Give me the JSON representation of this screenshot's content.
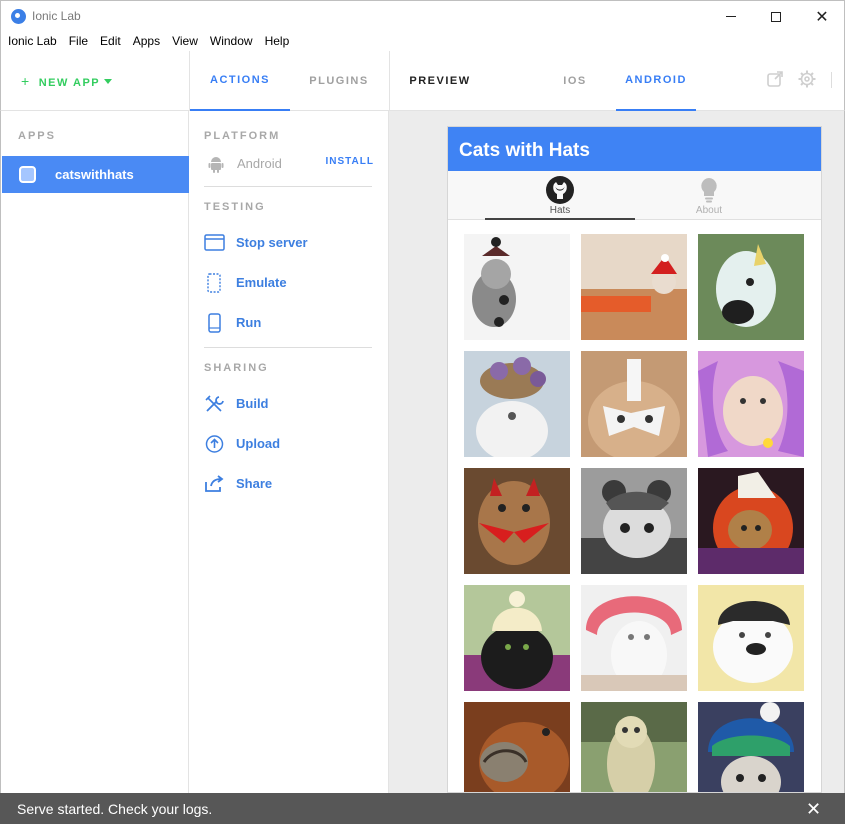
{
  "window": {
    "title": "Ionic Lab"
  },
  "menu": [
    "Ionic Lab",
    "File",
    "Edit",
    "Apps",
    "View",
    "Window",
    "Help"
  ],
  "header": {
    "new_app": "NEW APP",
    "tabs": {
      "actions": "ACTIONS",
      "plugins": "PLUGINS",
      "preview": "PREVIEW",
      "ios": "IOS",
      "android": "ANDROID"
    },
    "active_tab": "ACTIONS",
    "active_platform": "ANDROID"
  },
  "sidebar": {
    "section": "APPS",
    "apps": [
      {
        "name": "catswithhats",
        "selected": true
      }
    ]
  },
  "actions": {
    "platform_section": "PLATFORM",
    "platform": {
      "name": "Android",
      "action": "INSTALL"
    },
    "testing_section": "TESTING",
    "testing": [
      "Stop server",
      "Emulate",
      "Run"
    ],
    "sharing_section": "SHARING",
    "sharing": [
      "Build",
      "Upload",
      "Share"
    ]
  },
  "preview": {
    "app_title": "Cats with Hats",
    "tabs": [
      {
        "label": "Hats",
        "icon": "github-icon"
      },
      {
        "label": "About",
        "icon": "lightbulb-icon"
      }
    ],
    "active_tab": "Hats"
  },
  "toast": {
    "message": "Serve started. Check your logs."
  },
  "colors": {
    "accent": "#387ef5",
    "new_app": "#33cd5f",
    "selected_app": "#4a8af4",
    "device_header": "#3f83f4",
    "toast": "#575757"
  }
}
